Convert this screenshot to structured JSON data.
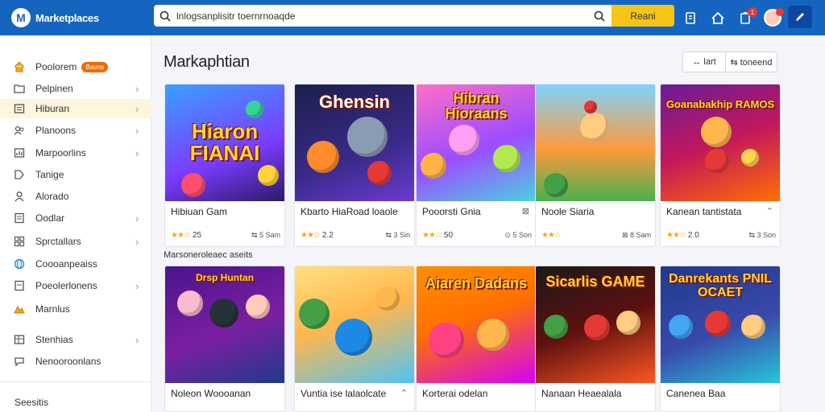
{
  "header": {
    "app_name": "Marketplaces",
    "logo_glyph": "M",
    "search_placeholder": "lnlogsanplisitr toernrnoaqde",
    "search_button": "Reani",
    "notification_count": "1"
  },
  "sidebar": {
    "items": [
      {
        "label": "Poolorem",
        "icon": "home-icon",
        "badge": "Bauns",
        "chevron": false,
        "active": false
      },
      {
        "label": "Pelpinen",
        "icon": "folder-icon",
        "chevron": true,
        "active": false
      },
      {
        "label": "Hiburan",
        "icon": "list-icon",
        "chevron": true,
        "active": true
      },
      {
        "label": "Planoons",
        "icon": "user-group-icon",
        "chevron": true,
        "active": false
      },
      {
        "label": "Marpoorlins",
        "icon": "chart-icon",
        "chevron": true,
        "active": false
      },
      {
        "label": "Tanige",
        "icon": "tag-icon",
        "chevron": false,
        "active": false
      },
      {
        "label": "Alorado",
        "icon": "person-icon",
        "chevron": false,
        "active": false
      },
      {
        "label": "Oodlar",
        "icon": "document-icon",
        "chevron": true,
        "active": false
      },
      {
        "label": "Sprctallars",
        "icon": "grid-icon",
        "chevron": true,
        "active": false
      },
      {
        "label": "Coooanpeaiss",
        "icon": "globe-icon",
        "chevron": false,
        "active": false
      },
      {
        "label": "Poeolerlonens",
        "icon": "page-icon",
        "chevron": true,
        "active": false
      },
      {
        "label": "Marnlus",
        "icon": "mountain-icon",
        "chevron": false,
        "active": false
      },
      {
        "label": "Stenhias",
        "icon": "table-icon",
        "chevron": true,
        "active": false
      },
      {
        "label": "Nenooroonlans",
        "icon": "chat-icon",
        "chevron": false,
        "active": false
      }
    ],
    "footer": "Seesitis"
  },
  "main": {
    "title": "Markaphtian",
    "view_buttons": [
      "↔ lart",
      "⇆ toneend"
    ],
    "section_label": "Marsoneroleaec aseits",
    "cards": [
      {
        "title": "Hibiuan Gam",
        "art_text": "Hiaron FIANAI",
        "rating": "25",
        "plays": "⇆ 5 Sam",
        "share": "",
        "theme": 0
      },
      {
        "title": "Kbarto HiaRoad loaole",
        "art_text": "Ghensin",
        "rating": "2.2",
        "plays": "⇆ 3 Sin",
        "share": "",
        "theme": 1
      },
      {
        "title": "Pooorsti Gnia",
        "art_text": "Hibran Hioraans",
        "rating": "50",
        "plays": "⊙ 5 Son",
        "share": "⊠",
        "theme": 2
      },
      {
        "title": "Noole Siaria",
        "art_text": "",
        "rating": "",
        "plays": "⊠ 8 Sam",
        "share": "",
        "theme": 3
      },
      {
        "title": "Kanean tantistata",
        "art_text": "Goanabakhip RAMOS",
        "rating": "2.0",
        "plays": "⇆ 3 Son",
        "share": "⌃",
        "theme": 4
      },
      {
        "title": "Noleon Woooanan",
        "art_text": "Drsp Huntan",
        "theme": 5
      },
      {
        "title": "Vuntia ise lalaolcate",
        "art_text": "",
        "share": "⌃",
        "theme": 6
      },
      {
        "title": "Korterai odelan",
        "art_text": "Aiaren Dadans",
        "theme": 7
      },
      {
        "title": "Nanaan Heaealala",
        "art_text": "Sicarlis GAME",
        "theme": 8
      },
      {
        "title": "Canenea Baa",
        "art_text": "Danrekants PNIL OCAET",
        "theme": 9
      }
    ]
  },
  "theme_colors": {
    "brand": "#1565c0",
    "search_button": "#f5c518",
    "badge": "#ef6c00",
    "active_item": "#fff4dc"
  }
}
